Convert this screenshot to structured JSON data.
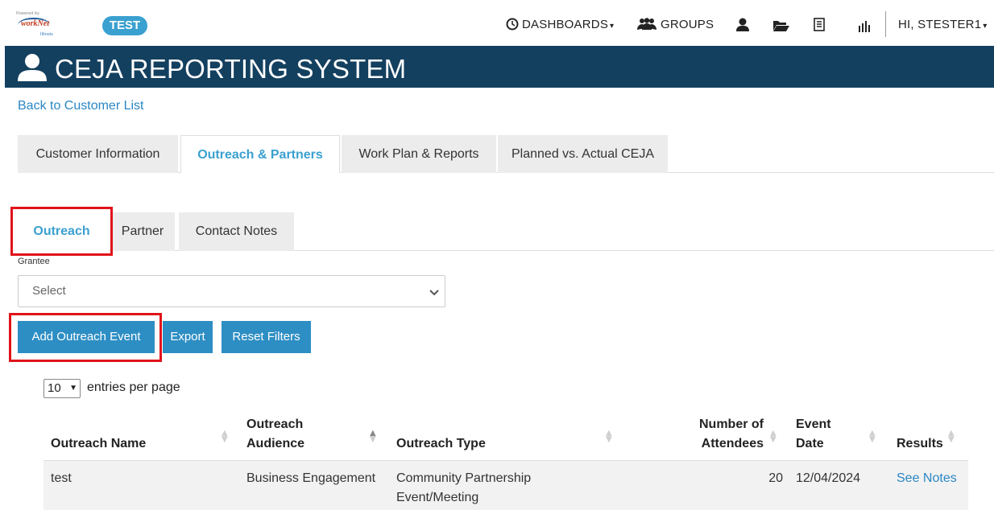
{
  "header": {
    "env_badge": "TEST",
    "logo": {
      "top_text": "Powered by",
      "brand": "workNet",
      "sub": "Illinois"
    },
    "nav": {
      "dashboards": "DASHBOARDS",
      "groups": "GROUPS",
      "user_greeting": "HI, STESTER1"
    },
    "icons": [
      "clock-icon",
      "groups-icon",
      "person-icon",
      "folder-icon",
      "list-icon",
      "bar-chart-icon"
    ]
  },
  "banner": {
    "title": "CEJA REPORTING SYSTEM"
  },
  "back_link": "Back to Customer List",
  "main_tabs": [
    {
      "label": "Customer Information",
      "active": false
    },
    {
      "label": "Outreach & Partners",
      "active": true
    },
    {
      "label": "Work Plan & Reports",
      "active": false
    },
    {
      "label": "Planned vs. Actual CEJA",
      "active": false
    }
  ],
  "sub_tabs": [
    {
      "label": "Outreach",
      "active": true
    },
    {
      "label": "Partner",
      "active": false
    },
    {
      "label": "Contact Notes",
      "active": false
    }
  ],
  "filter": {
    "label": "Grantee",
    "selected": "Select"
  },
  "buttons": {
    "add_outreach": "Add Outreach Event",
    "export": "Export",
    "reset_filters": "Reset Filters"
  },
  "pagination": {
    "entries_value": "10",
    "entries_label": "entries per page"
  },
  "table": {
    "columns": [
      {
        "line1": "",
        "line2": "Outreach Name"
      },
      {
        "line1": "Outreach",
        "line2": "Audience"
      },
      {
        "line1": "",
        "line2": "Outreach Type"
      },
      {
        "line1": "Number of",
        "line2": "Attendees"
      },
      {
        "line1": "Event",
        "line2": "Date"
      },
      {
        "line1": "",
        "line2": "Results"
      }
    ],
    "rows": [
      {
        "name": "test",
        "audience": "Business Engagement",
        "type_line1": "Community Partnership",
        "type_line2": "Event/Meeting",
        "attendees": "20",
        "date": "12/04/2024",
        "results": "See Notes"
      }
    ]
  },
  "colors": {
    "banner": "#14405f",
    "accent": "#3aa0d0",
    "button": "#2d8ec4",
    "highlight": "#e0131b"
  }
}
